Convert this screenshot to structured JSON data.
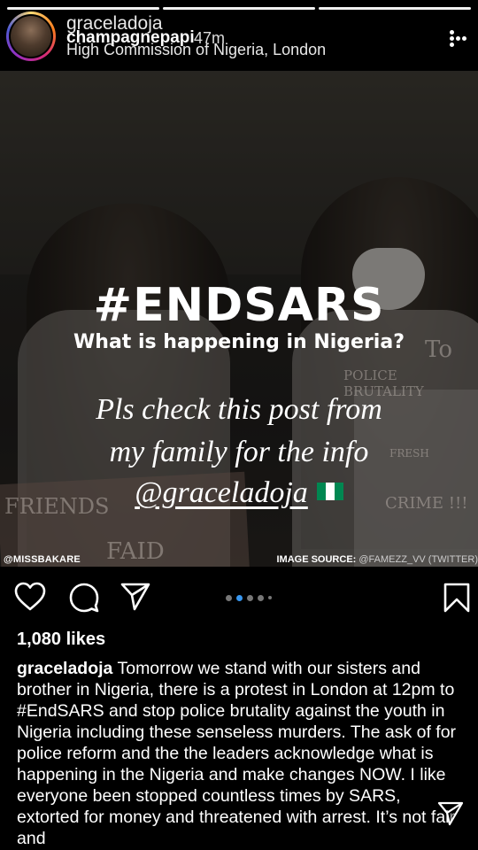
{
  "story": {
    "segments": 3,
    "username": "graceladoja",
    "poster": "champagnepapi",
    "time": "47m",
    "location": "High Commission of Nigeria, London"
  },
  "post": {
    "headline": "#ENDSARS",
    "subhead": "What is happening in Nigeria?",
    "message_line1": "Pls check this post from",
    "message_line2": "my family for the info",
    "mention": "@graceladoja",
    "credit_left": "@MISSBAKARE",
    "credit_right_label": "IMAGE SOURCE:",
    "credit_right_value": "@FAMEZZ_VV (TWITTER)",
    "sign_texts": [
      "To",
      "POLICE BRUTALITY",
      "FRESH",
      "CRIME !!!",
      "FRIENDS",
      "FAID"
    ],
    "flag_colors": [
      "#008751",
      "#ffffff",
      "#008751"
    ]
  },
  "actions": {
    "like_icon": "heart-icon",
    "comment_icon": "comment-icon",
    "share_icon": "send-icon",
    "save_icon": "bookmark-icon",
    "carousel_count": 5,
    "carousel_active": 1,
    "accent": "#3897f0"
  },
  "likes": "1,080 likes",
  "caption": {
    "author": "graceladoja",
    "text": "Tomorrow we stand with our sisters and brother in Nigeria, there is a protest in London at 12pm to #EndSARS and stop police brutality against the youth in Nigeria including these senseless murders. The ask of for police reform and the the leaders acknowledge what is happening in the Nigeria and make changes NOW. I like everyone been stopped countless times by SARS, extorted for money and threatened with arrest. It’s not fair and"
  }
}
